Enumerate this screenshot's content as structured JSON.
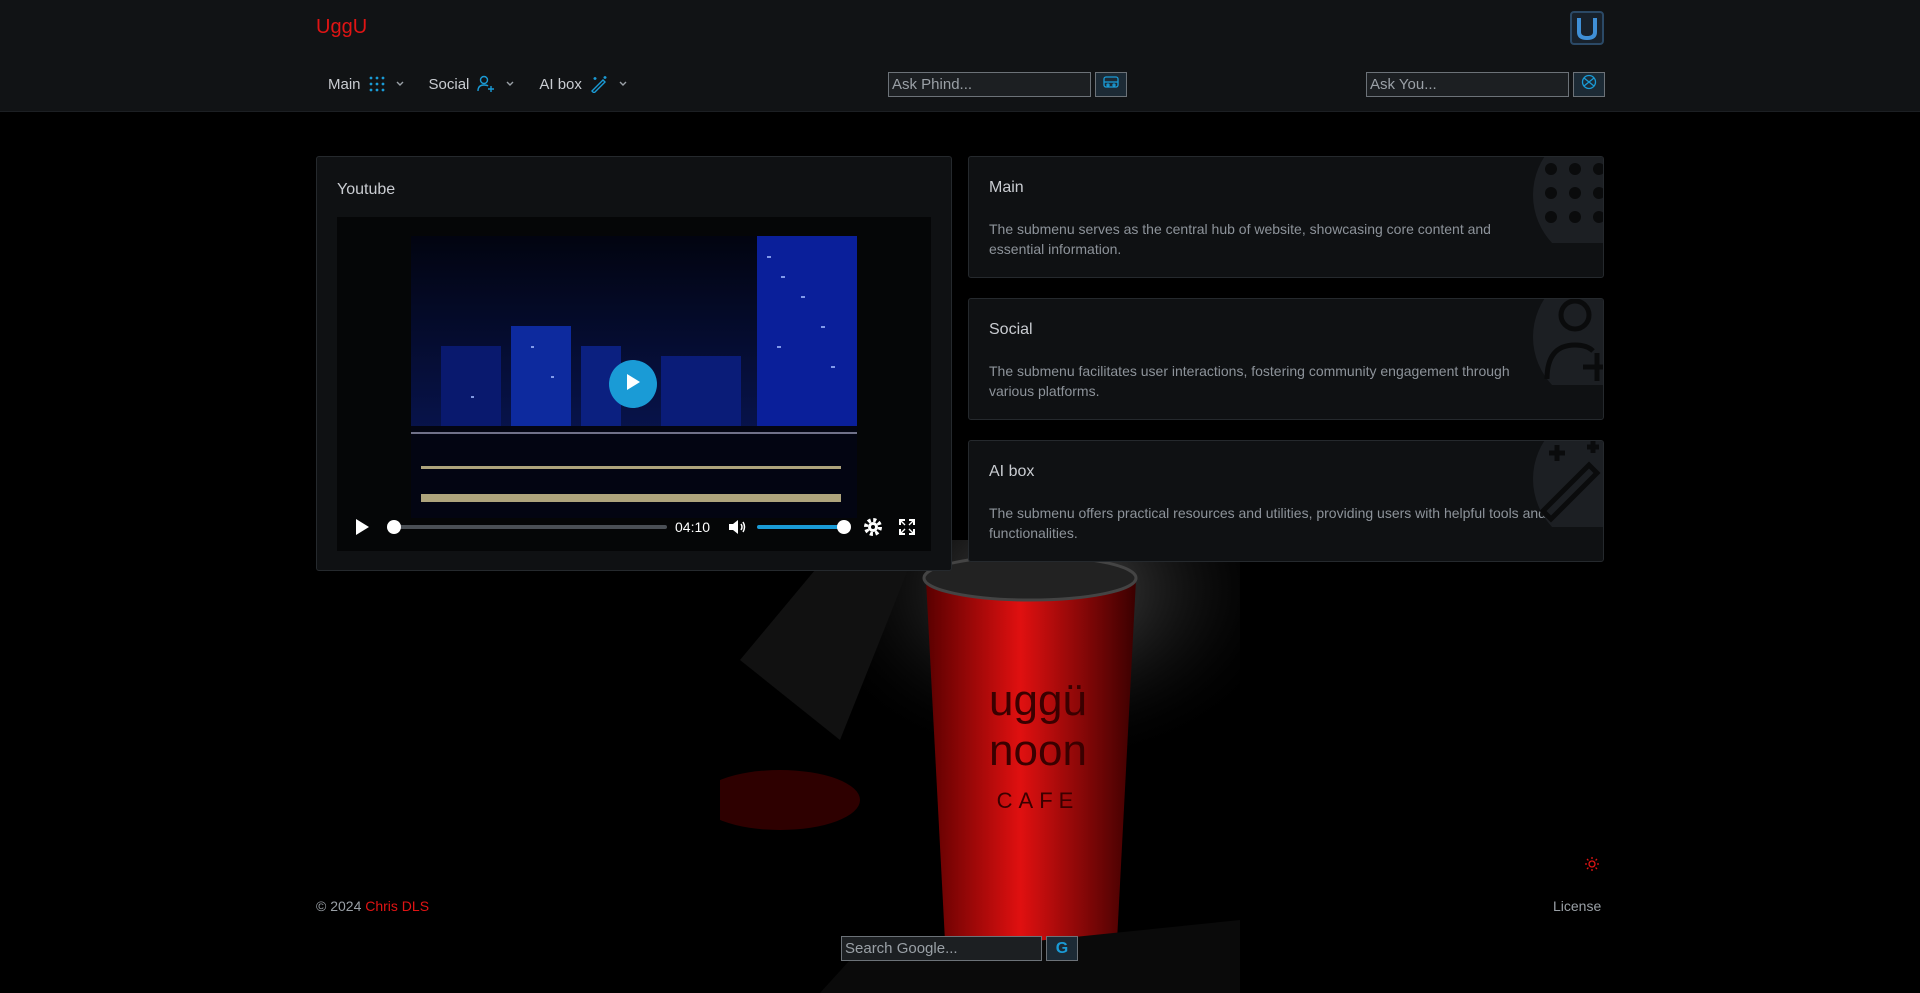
{
  "header": {
    "brand": "UggU",
    "corner_logo_letter": "U",
    "nav": [
      {
        "label": "Main",
        "icon": "grid-dots-icon"
      },
      {
        "label": "Social",
        "icon": "user-plus-icon"
      },
      {
        "label": "AI box",
        "icon": "magic-wand-icon"
      }
    ],
    "ask_phind": {
      "placeholder": "Ask Phind...",
      "icon": "robot-icon"
    },
    "ask_you": {
      "placeholder": "Ask You...",
      "icon": "compass-icon"
    }
  },
  "youtube": {
    "title": "Youtube",
    "player": {
      "duration": "04:10",
      "progress": 0,
      "volume": 1.0
    }
  },
  "submenus": [
    {
      "title": "Main",
      "description": "The submenu serves as the central hub of website, showcasing core content and essential information.",
      "icon": "grid-dots-icon"
    },
    {
      "title": "Social",
      "description": "The submenu facilitates user interactions, fostering community engagement through various platforms.",
      "icon": "user-plus-icon"
    },
    {
      "title": "AI box",
      "description": "The submenu offers practical resources and utilities, providing users with helpful tools and functionalities.",
      "icon": "magic-wand-icon"
    }
  ],
  "footer": {
    "copyright": "© 2024",
    "author": "Chris DLS",
    "license": "License",
    "search_google": {
      "placeholder": "Search Google...",
      "button": "G"
    }
  },
  "colors": {
    "brand_red": "#e01414",
    "accent_blue": "#1a9bd6",
    "header_bg": "#111315",
    "card_bg": "#0f1113"
  }
}
